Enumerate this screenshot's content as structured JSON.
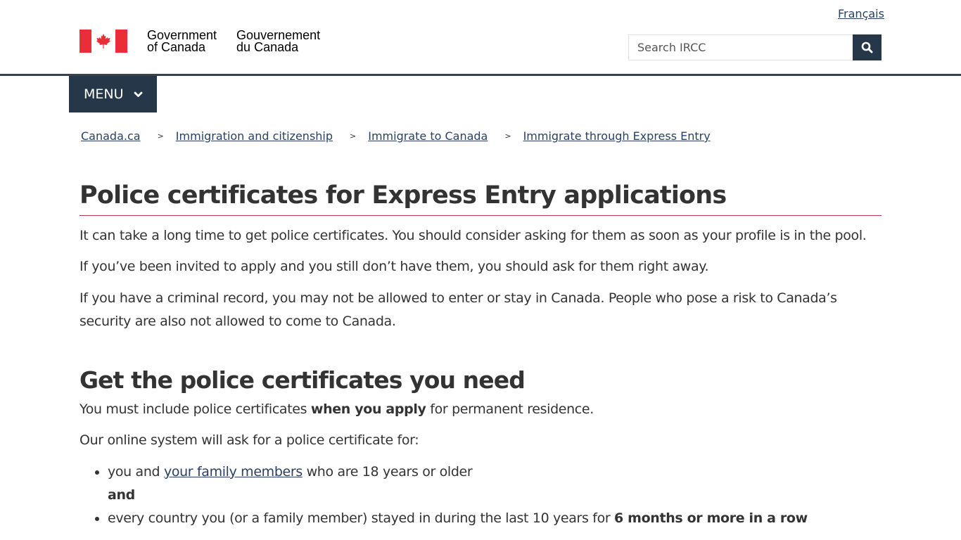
{
  "header": {
    "language_link": "Français",
    "logo": {
      "en_line1": "Government",
      "en_line2": "of Canada",
      "fr_line1": "Gouvernement",
      "fr_line2": "du Canada"
    },
    "search": {
      "placeholder": "Search IRCC",
      "value": "",
      "button_icon": "search-icon"
    },
    "menu_label": "MENU"
  },
  "breadcrumb": [
    {
      "label": "Canada.ca"
    },
    {
      "label": "Immigration and citizenship"
    },
    {
      "label": "Immigrate to Canada"
    },
    {
      "label": "Immigrate through Express Entry"
    }
  ],
  "breadcrumb_separator": ">",
  "main": {
    "title": "Police certificates for Express Entry applications",
    "intro": [
      "It can take a long time to get police certificates. You should consider asking for them as soon as your profile is in the pool.",
      "If you’ve been invited to apply and you still don’t have them, you should ask for them right away.",
      "If you have a criminal record, you may not be allowed to enter or stay in Canada. People who pose a risk to Canada’s security are also not allowed to come to Canada."
    ],
    "section_heading": "Get the police certificates you need",
    "must_include": {
      "before": "You must include police certificates ",
      "bold": "when you apply",
      "after": " for permanent residence."
    },
    "online_system": "Our online system will ask for a police certificate for:",
    "list": {
      "item1_before": "you and ",
      "item1_link": "your family members",
      "item1_after": " who are 18 years or older",
      "item1_and": "and",
      "item2_before": "every country you (or a family member) stayed in during the last 10 years for ",
      "item2_bold": "6 months or more in a row"
    }
  },
  "colors": {
    "brand_dark": "#26374a",
    "flag_red": "#eb2d37",
    "title_rule": "#af3c43",
    "link": "#284162"
  }
}
